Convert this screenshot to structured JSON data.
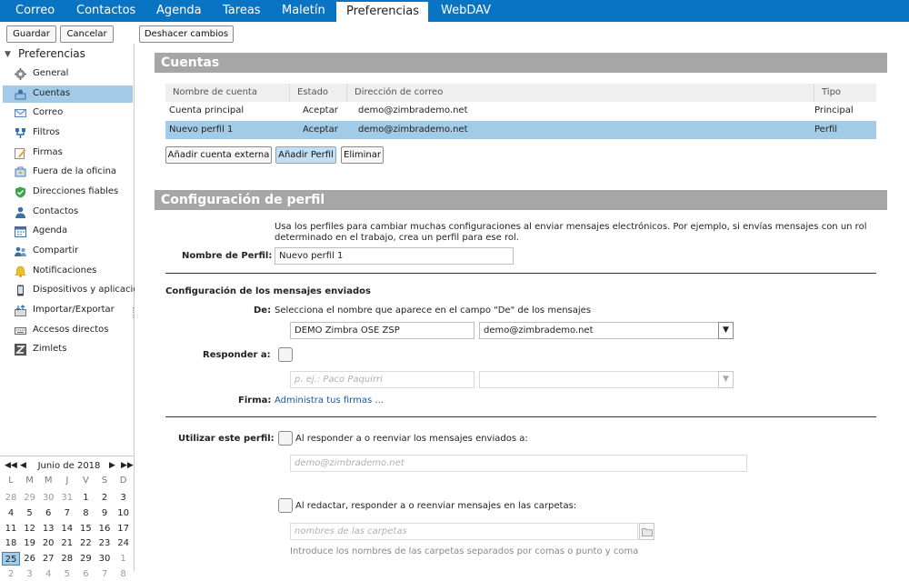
{
  "app_tabs": [
    "Correo",
    "Contactos",
    "Agenda",
    "Tareas",
    "Maletín",
    "Preferencias",
    "WebDAV"
  ],
  "toolbar": {
    "save": "Guardar",
    "cancel": "Cancelar",
    "undo": "Deshacer cambios"
  },
  "sidebar": {
    "title": "Preferencias",
    "items": [
      {
        "label": "General",
        "icon": "gear-icon"
      },
      {
        "label": "Cuentas",
        "icon": "accounts-icon"
      },
      {
        "label": "Correo",
        "icon": "mail-icon"
      },
      {
        "label": "Filtros",
        "icon": "filter-icon"
      },
      {
        "label": "Firmas",
        "icon": "signature-icon"
      },
      {
        "label": "Fuera de la oficina",
        "icon": "out-of-office-icon"
      },
      {
        "label": "Direcciones fiables",
        "icon": "trusted-shield-icon"
      },
      {
        "label": "Contactos",
        "icon": "contact-icon"
      },
      {
        "label": "Agenda",
        "icon": "calendar-icon"
      },
      {
        "label": "Compartir",
        "icon": "share-icon"
      },
      {
        "label": "Notificaciones",
        "icon": "bell-icon"
      },
      {
        "label": "Dispositivos y aplicaciones",
        "icon": "device-icon"
      },
      {
        "label": "Importar/Exportar",
        "icon": "import-export-icon"
      },
      {
        "label": "Accesos directos",
        "icon": "shortcut-icon"
      },
      {
        "label": "Zimlets",
        "icon": "zimlet-icon"
      }
    ]
  },
  "calendar": {
    "month": "Junio de 2018",
    "weekdays": [
      "L",
      "M",
      "M",
      "J",
      "V",
      "S",
      "D"
    ],
    "weeks": [
      [
        "28",
        "29",
        "30",
        "31",
        "1",
        "2",
        "3"
      ],
      [
        "4",
        "5",
        "6",
        "7",
        "8",
        "9",
        "10"
      ],
      [
        "11",
        "12",
        "13",
        "14",
        "15",
        "16",
        "17"
      ],
      [
        "18",
        "19",
        "20",
        "21",
        "22",
        "23",
        "24"
      ],
      [
        "25",
        "26",
        "27",
        "28",
        "29",
        "30",
        "1"
      ],
      [
        "2",
        "3",
        "4",
        "5",
        "6",
        "7",
        "8"
      ]
    ],
    "today": "25"
  },
  "accounts": {
    "title": "Cuentas",
    "columns": [
      "Nombre de cuenta",
      "Estado",
      "Dirección de correo",
      "Tipo"
    ],
    "rows": [
      {
        "name": "Cuenta principal",
        "status": "Aceptar",
        "email": "demo@zimbrademo.net",
        "type": "Principal"
      },
      {
        "name": "Nuevo perfil 1",
        "status": "Aceptar",
        "email": "demo@zimbrademo.net",
        "type": "Perfil"
      }
    ],
    "btn_external": "Añadir cuenta externa",
    "btn_profile": "Añadir Perfil",
    "btn_delete": "Eliminar"
  },
  "profile": {
    "title": "Configuración de perfil",
    "intro_line1": "Usa los perfiles para cambiar muchas configuraciones al enviar mensajes electrónicos. Por ejemplo, si envías mensajes con un rol",
    "intro_line2": "determinado en el trabajo, crea un perfil para ese rol.",
    "name_label": "Nombre de Perfil:",
    "name_value": "Nuevo perfil 1",
    "sent_title": "Configuración de los mensajes enviados",
    "de_label": "De:",
    "de_hint": "Selecciona el nombre que aparece en el campo \"De\" de los mensajes",
    "from_name": "DEMO Zimbra OSE ZSP",
    "from_email": "demo@zimbrademo.net",
    "reply_label": "Responder a:",
    "reply_placeholder": "p. ej.: Paco Paquirri",
    "firma_label": "Firma:",
    "firma_link": "Administra tus firmas ...",
    "use_label": "Utilizar este perfil:",
    "use_opt1": "Al responder a o reenviar los mensajes enviados a:",
    "use_opt1_placeholder": "demo@zimbrademo.net",
    "use_opt2": "Al redactar, responder a o reenviar mensajes en las carpetas:",
    "use_opt2_placeholder": "nombres de las carpetas",
    "folders_hint": "Introduce los nombres de las carpetas separados por comas o punto y coma"
  }
}
